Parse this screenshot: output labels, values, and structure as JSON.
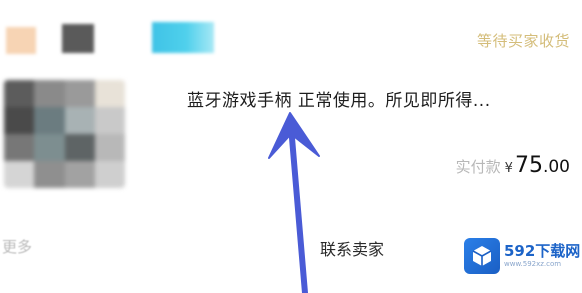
{
  "header": {
    "order_status": "等待买家收货"
  },
  "product": {
    "title": "蓝牙游戏手柄 正常使用。所见即所得...",
    "price_label": "实付款",
    "currency": "¥",
    "price_int": "75",
    "price_dec": ".00"
  },
  "footer": {
    "more_label": "更多",
    "contact_label": "联系卖家"
  },
  "watermark": {
    "brand": "592下载网",
    "url": "www.592xz.com"
  },
  "colors": {
    "status_gold": "#d4bd7a",
    "arrow_blue": "#4a5bd6",
    "watermark_blue": "#1d64c8"
  },
  "icons": {
    "arrow": "annotation-arrow-up",
    "watermark_logo": "cube-icon"
  }
}
